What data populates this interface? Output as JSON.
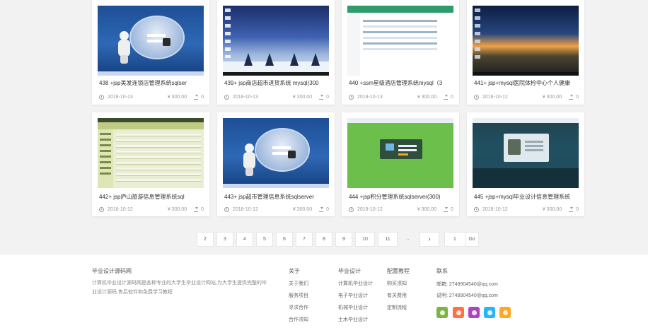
{
  "cards": [
    {
      "title": "438 +jsp美发连锁店管理系统sqlser",
      "date": "2018-10-13",
      "price": "¥ 300.00",
      "downloads": "0",
      "thumb": "login-page-screenshot"
    },
    {
      "title": "439+ jsp商店超市进货系统 mysql(300",
      "date": "2018-10-13",
      "price": "¥ 300.00",
      "downloads": "0",
      "thumb": "snow-desktop-screenshot"
    },
    {
      "title": "440 +ssm星级酒店管理系统mysql（3",
      "date": "2018-10-13",
      "price": "¥ 300.00",
      "downloads": "0",
      "thumb": "table-admin-screenshot"
    },
    {
      "title": "441+ jsp+mysql医院体检中心个人健康",
      "date": "2018-10-12",
      "price": "¥ 300.00",
      "downloads": "0",
      "thumb": "sunset-desktop-screenshot"
    },
    {
      "title": "442+ jsp庐山旅游信息管理系统sql",
      "date": "2018-10-12",
      "price": "¥ 300.00",
      "downloads": "0",
      "thumb": "yellow-admin-screenshot"
    },
    {
      "title": "443+ jsp超市管理信息系统sqlserver",
      "date": "2018-10-12",
      "price": "¥ 300.00",
      "downloads": "0",
      "thumb": "login-page-screenshot"
    },
    {
      "title": "444 +jsp积分管理系统sqlserver(300)",
      "date": "2018-10-12",
      "price": "¥ 300.00",
      "downloads": "0",
      "thumb": "green-login-screenshot"
    },
    {
      "title": "445 +jsp+mysql毕业设计信息管理系统",
      "date": "2018-10-12",
      "price": "¥ 300.00",
      "downloads": "0",
      "thumb": "blue-login-screenshot"
    }
  ],
  "pagination": {
    "pages": [
      "2",
      "3",
      "4",
      "5",
      "6",
      "7",
      "8",
      "9",
      "10",
      "11"
    ],
    "ellipsis": "..",
    "next": "›",
    "goto_value": "1",
    "go_label": "Go"
  },
  "footer": {
    "site_title": "毕业设计源码网",
    "description": "计算机毕业设计源码网是各种专业的大学生毕业设计网站,为大学生提供完整的毕业设计源码,售后软件和免费学习教程",
    "columns": [
      {
        "title": "关于",
        "links": [
          "关于我们",
          "服务项目",
          "寻求合作",
          "合作须知"
        ]
      },
      {
        "title": "毕业设计",
        "links": [
          "计算机毕业设计",
          "电子毕业设计",
          "机械毕业设计",
          "土木毕业设计"
        ]
      },
      {
        "title": "配置教程",
        "links": [
          "购买须知",
          "有关费用",
          "定制流程"
        ]
      }
    ],
    "contact": {
      "title": "联系",
      "email": "邮箱: 2748904540@qq.com",
      "alt": "说明: 2748904540@qq.com"
    },
    "social_colors": [
      "#7cb342",
      "#ff7043",
      "#ab47bc",
      "#29b6f6",
      "#ffa726"
    ],
    "social_icons": [
      "weibo-icon",
      "cart-icon",
      "qq-icon",
      "rss-icon",
      "wechat-icon"
    ]
  }
}
